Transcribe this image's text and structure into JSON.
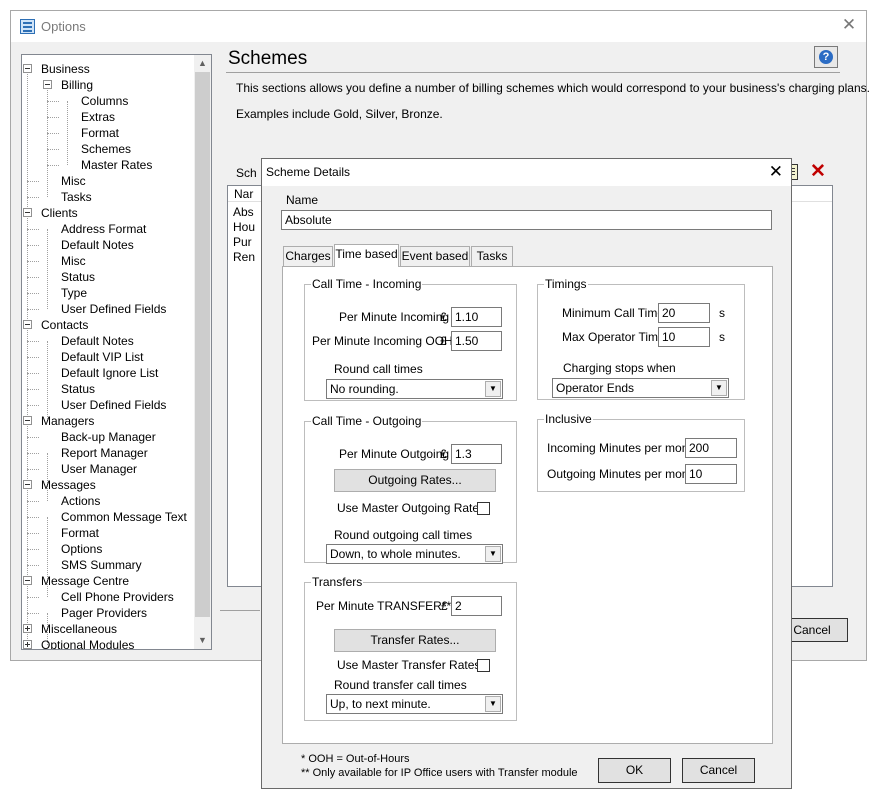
{
  "window": {
    "title": "Options"
  },
  "tree": {
    "nodes": [
      {
        "label": "Business"
      },
      {
        "label": "Billing"
      },
      {
        "label": "Columns"
      },
      {
        "label": "Extras"
      },
      {
        "label": "Format"
      },
      {
        "label": "Schemes"
      },
      {
        "label": "Master Rates"
      },
      {
        "label": "Misc"
      },
      {
        "label": "Tasks"
      },
      {
        "label": "Clients"
      },
      {
        "label": "Address Format"
      },
      {
        "label": "Default Notes"
      },
      {
        "label": "Misc"
      },
      {
        "label": "Status"
      },
      {
        "label": "Type"
      },
      {
        "label": "User Defined Fields"
      },
      {
        "label": "Contacts"
      },
      {
        "label": "Default Notes"
      },
      {
        "label": "Default VIP List"
      },
      {
        "label": "Default Ignore List"
      },
      {
        "label": "Status"
      },
      {
        "label": "User Defined Fields"
      },
      {
        "label": "Managers"
      },
      {
        "label": "Back-up Manager"
      },
      {
        "label": "Report Manager"
      },
      {
        "label": "User Manager"
      },
      {
        "label": "Messages"
      },
      {
        "label": "Actions"
      },
      {
        "label": "Common Message Text"
      },
      {
        "label": "Format"
      },
      {
        "label": "Options"
      },
      {
        "label": "SMS Summary"
      },
      {
        "label": "Message Centre"
      },
      {
        "label": "Cell Phone Providers"
      },
      {
        "label": "Pager Providers"
      },
      {
        "label": "Miscellaneous"
      },
      {
        "label": "Optional Modules"
      }
    ]
  },
  "schemes_page": {
    "title": "Schemes",
    "description": "This sections allows you define a number of billing schemes which would correspond to your business's charging plans.",
    "examples": "Examples include Gold, Silver, Bronze.",
    "list_label": "Sch",
    "list_header": "Nar",
    "rows": [
      "Abs",
      "Hou",
      "Pur",
      "Ren"
    ],
    "cancel_label": "Cancel"
  },
  "dialog": {
    "title": "Scheme Details",
    "name_label": "Name",
    "name_value": "Absolute",
    "tabs": [
      "Charges",
      "Time based",
      "Event based",
      "Tasks"
    ],
    "active_tab": "Time based",
    "incoming": {
      "title": "Call Time - Incoming",
      "per_minute_label": "Per Minute Incoming",
      "currency": "£",
      "per_minute_value": "1.10",
      "ooh_label": "Per Minute Incoming OOH",
      "ooh_value": "1.50",
      "round_label": "Round call times",
      "round_value": "No rounding."
    },
    "outgoing": {
      "title": "Call Time - Outgoing",
      "per_minute_label": "Per Minute Outgoing",
      "currency": "£",
      "per_minute_value": "1.3",
      "rates_button": "Outgoing Rates...",
      "use_master_label": "Use Master Outgoing Rates",
      "round_label": "Round outgoing call times",
      "round_value": "Down, to whole minutes."
    },
    "transfers": {
      "title": "Transfers",
      "per_minute_label": "Per Minute TRANSFER**",
      "currency": "£",
      "per_minute_value": "2",
      "rates_button": "Transfer Rates...",
      "use_master_label": "Use Master Transfer Rates",
      "round_label": "Round transfer call times",
      "round_value": "Up, to next minute."
    },
    "timings": {
      "title": "Timings",
      "min_call_label": "Minimum Call  Time",
      "min_call_value": "20",
      "min_call_unit": "s",
      "max_op_label": "Max Operator Time",
      "max_op_value": "10",
      "max_op_unit": "s",
      "charging_label": "Charging stops when",
      "charging_value": "Operator Ends"
    },
    "inclusive": {
      "title": "Inclusive",
      "incoming_label": "Incoming Minutes per month",
      "incoming_value": "200",
      "outgoing_label": "Outgoing Minutes per month",
      "outgoing_value": "10"
    },
    "footnote1": "* OOH = Out-of-Hours",
    "footnote2": "** Only available for IP Office users with Transfer module",
    "ok_label": "OK",
    "cancel_label": "Cancel"
  }
}
